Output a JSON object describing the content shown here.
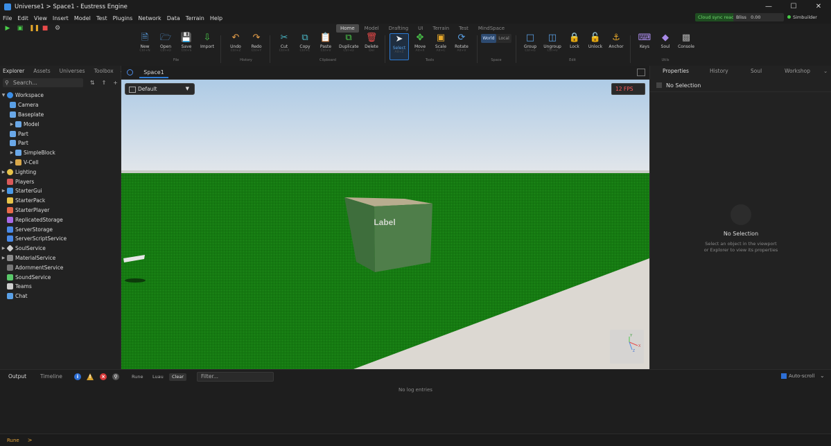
{
  "window": {
    "title": "Universe1 > Space1 - Eustress Engine"
  },
  "menu": [
    "File",
    "Edit",
    "View",
    "Insert",
    "Model",
    "Test",
    "Plugins",
    "Network",
    "Data",
    "Terrain",
    "Help"
  ],
  "status": {
    "sync": "Cloud sync ready",
    "bliss_label": "Bliss",
    "bliss_value": "0.00",
    "user": "Simbuilder"
  },
  "ribbon_tabs": [
    "Home",
    "Model",
    "Drafting",
    "UI",
    "Terrain",
    "Test",
    "MindSpace"
  ],
  "ribbon": {
    "new": {
      "label": "New",
      "shortcut": "Ctrl+N"
    },
    "open": {
      "label": "Open",
      "shortcut": "Ctrl+O"
    },
    "save": {
      "label": "Save",
      "shortcut": "Ctrl+S"
    },
    "import": {
      "label": "Import"
    },
    "undo": {
      "label": "Undo",
      "shortcut": "Ctrl+Z"
    },
    "redo": {
      "label": "Redo",
      "shortcut": "Ctrl+Y"
    },
    "cut": {
      "label": "Cut",
      "shortcut": "Ctrl+X"
    },
    "copy": {
      "label": "Copy",
      "shortcut": "Ctrl+C"
    },
    "paste": {
      "label": "Paste",
      "shortcut": "Ctrl+V"
    },
    "duplicate": {
      "label": "Duplicate",
      "shortcut": "Ctrl+D"
    },
    "delete": {
      "label": "Delete",
      "shortcut": "Del"
    },
    "select": {
      "label": "Select",
      "shortcut": "Alt+Z"
    },
    "move": {
      "label": "Move",
      "shortcut": "Alt+X"
    },
    "scale": {
      "label": "Scale",
      "shortcut": "Alt+C"
    },
    "rotate": {
      "label": "Rotate",
      "shortcut": "Alt+V"
    },
    "world": "World",
    "local": "Local",
    "group": {
      "label": "Group",
      "shortcut": "Ctrl+G"
    },
    "ungroup": {
      "label": "Ungroup",
      "shortcut": "Ctrl+U"
    },
    "lock": {
      "label": "Lock"
    },
    "unlock": {
      "label": "Unlock"
    },
    "anchor": {
      "label": "Anchor"
    },
    "keys": {
      "label": "Keys"
    },
    "soul": {
      "label": "Soul"
    },
    "console": {
      "label": "Console"
    },
    "groups": {
      "file": "File",
      "history": "History",
      "clipboard": "Clipboard",
      "tools": "Tools",
      "space": "Space",
      "edit": "Edit",
      "utils": "Utils"
    }
  },
  "explorer": {
    "tabs": [
      "Explorer",
      "Assets",
      "Universes",
      "Toolbox"
    ],
    "search_placeholder": "Search...",
    "items": [
      {
        "label": "Workspace",
        "color": "#3b8ee6"
      },
      {
        "label": "Camera",
        "color": "#5aa0e6"
      },
      {
        "label": "Baseplate",
        "color": "#6aa8e8"
      },
      {
        "label": "Model",
        "color": "#6aa8e8"
      },
      {
        "label": "Part",
        "color": "#6aa8e8"
      },
      {
        "label": "Part",
        "color": "#6aa8e8"
      },
      {
        "label": "SimpleBlock",
        "color": "#6aa8e8"
      },
      {
        "label": "V-Cell",
        "color": "#d9a84a"
      },
      {
        "label": "Lighting",
        "color": "#e8c44a"
      },
      {
        "label": "Players",
        "color": "#d95a5a"
      },
      {
        "label": "StarterGui",
        "color": "#4a9ae8"
      },
      {
        "label": "StarterPack",
        "color": "#e8c44a"
      },
      {
        "label": "StarterPlayer",
        "color": "#e86a4a"
      },
      {
        "label": "ReplicatedStorage",
        "color": "#a86ae8"
      },
      {
        "label": "ServerStorage",
        "color": "#4a8ae8"
      },
      {
        "label": "ServerScriptService",
        "color": "#4a8ae8"
      },
      {
        "label": "SoulService",
        "color": "#cfcfcf"
      },
      {
        "label": "MaterialService",
        "color": "#8a8a8a"
      },
      {
        "label": "AdornmentService",
        "color": "#777777"
      },
      {
        "label": "SoundService",
        "color": "#5ac86a"
      },
      {
        "label": "Teams",
        "color": "#cfcfcf"
      },
      {
        "label": "Chat",
        "color": "#5aa0e6"
      }
    ]
  },
  "viewport": {
    "tab": "Space1",
    "camera": "Default",
    "fps": "12 FPS",
    "part_label": "Label",
    "gizmo": {
      "y": "Y",
      "x": "X",
      "z": "Z"
    }
  },
  "properties": {
    "tabs": [
      "Properties",
      "History",
      "Soul",
      "Workshop"
    ],
    "header": "No Selection",
    "empty_title": "No Selection",
    "empty_text_1": "Select an object in the viewport",
    "empty_text_2": "or Explorer to view its properties"
  },
  "output": {
    "tabs": [
      "Output",
      "Timeline"
    ],
    "rune": "Rune",
    "luau": "Luau",
    "clear": "Clear",
    "filter_placeholder": "Filter...",
    "autoscroll": "Auto-scroll",
    "empty": "No log entries"
  },
  "command": {
    "mode": "Rune",
    "prompt": ">"
  }
}
